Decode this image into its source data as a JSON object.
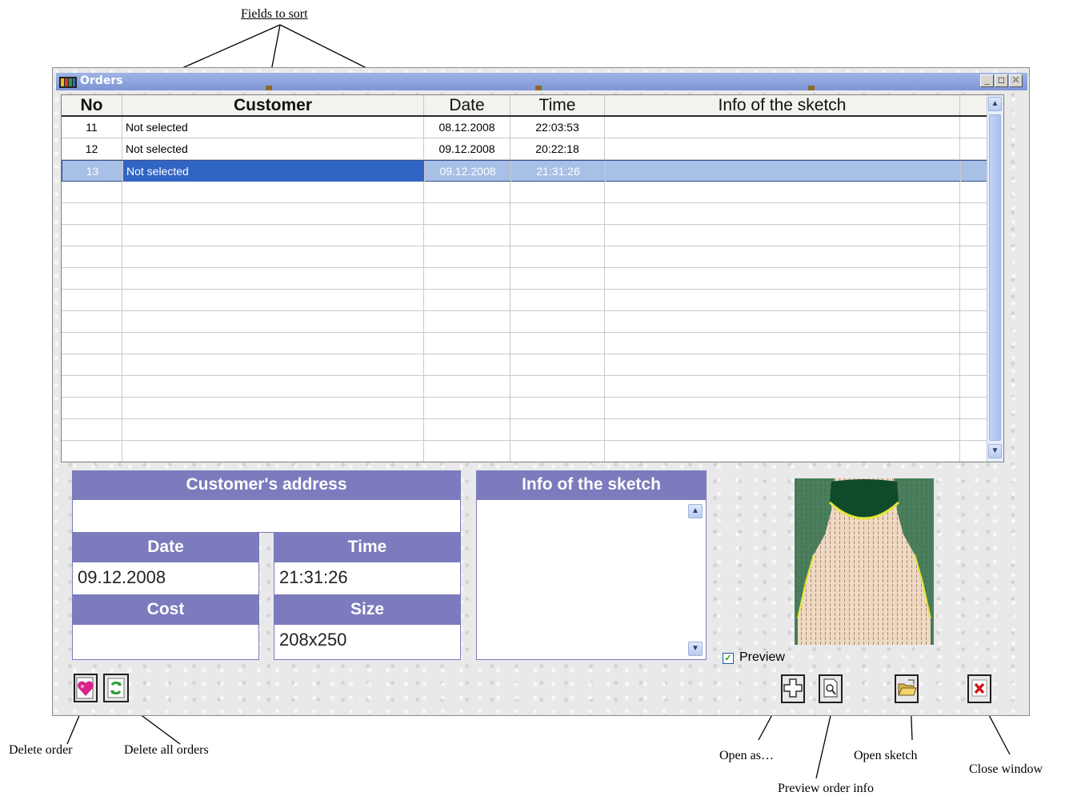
{
  "annotations": {
    "fields_to_sort": "Fields to sort",
    "delete_order": "Delete order",
    "delete_all_orders": "Delete all orders",
    "open_as": "Open as…",
    "preview_order_info": "Preview order info",
    "open_sketch": "Open sketch",
    "close_window": "Close window"
  },
  "window": {
    "title": "Orders",
    "minimize_icon": "minimize-icon",
    "maximize_icon": "maximize-icon",
    "close_icon": "close-icon"
  },
  "grid": {
    "columns": [
      "No",
      "Customer",
      "Date",
      "Time",
      "Info of the sketch"
    ],
    "rows": [
      {
        "no": "11",
        "customer": "Not selected",
        "date": "08.12.2008",
        "time": "22:03:53",
        "info": ""
      },
      {
        "no": "12",
        "customer": "Not selected",
        "date": "09.12.2008",
        "time": "20:22:18",
        "info": ""
      },
      {
        "no": "13",
        "customer": "Not selected",
        "date": "09.12.2008",
        "time": "21:31:26",
        "info": ""
      }
    ],
    "selected_row_index": 2
  },
  "details": {
    "customer_address_label": "Customer's address",
    "customer_address_value": "",
    "date_label": "Date",
    "date_value": "09.12.2008",
    "time_label": "Time",
    "time_value": "21:31:26",
    "cost_label": "Cost",
    "cost_value": "",
    "size_label": "Size",
    "size_value": "208x250",
    "sketch_info_label": "Info of the sketch",
    "sketch_info_value": ""
  },
  "preview": {
    "label": "Preview",
    "checked": true
  },
  "colors": {
    "titlebar": "#8aa2df",
    "selection": "#3165c4",
    "panel_header": "#7b7bbd",
    "sketch_green": "#4a7e5c",
    "sketch_dark": "#0f4a2a",
    "sketch_beige": "#efd9c3"
  },
  "icons": {
    "delete_order": "heart-delete-icon",
    "delete_all_orders": "refresh-delete-icon",
    "open_as": "plus-icon",
    "preview_order_info": "magnifier-page-icon",
    "open_sketch": "open-folder-icon",
    "close_window": "red-x-icon"
  }
}
